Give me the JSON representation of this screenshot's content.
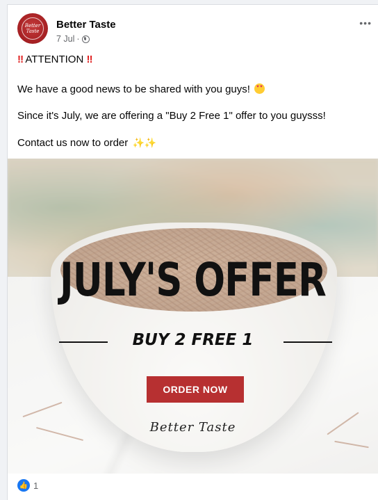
{
  "post": {
    "page_name": "Better Taste",
    "avatar_text": "Better Taste",
    "date": "7 Jul",
    "separator": "·",
    "privacy_icon": "globe-icon",
    "more_icon": "more-options-icon",
    "more_text": "•••",
    "attention_bang": "‼",
    "attention": "ATTENTION",
    "line1": "We have a good news to be shared with you guys!",
    "line1_emoji": "heart-eyes-emoji",
    "line2": "Since it's July, we are offering a \"Buy 2 Free 1\" offer to you guysss!",
    "line3": "Contact us now to order",
    "line3_emoji": "✨✨"
  },
  "image": {
    "headline": "JULY'S OFFER",
    "subline": "BUY 2 FREE 1",
    "button_label": "ORDER NOW",
    "signature": "Better Taste"
  },
  "reactions": {
    "icon": "like-icon",
    "count": "1"
  },
  "colors": {
    "brand_red": "#b73031",
    "like_blue": "#1877f2",
    "muted_text": "#65676b"
  }
}
